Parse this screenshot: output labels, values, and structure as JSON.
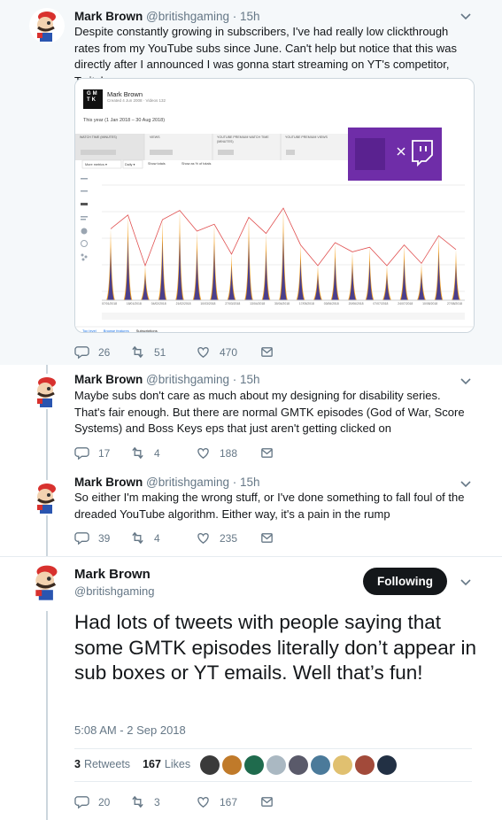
{
  "user": {
    "name": "Mark Brown",
    "handle": "@britishgaming"
  },
  "tweets": [
    {
      "time": "· 15h",
      "text": "Despite constantly growing in subscribers, I've had really low clickthrough rates from my YouTube subs since June. Can't help but notice that this was directly after I announced I was gonna start streaming on YT's competitor, Twitch...",
      "replies": "26",
      "retweets": "51",
      "likes": "470"
    },
    {
      "time": "· 15h",
      "text": "Maybe subs don't care as much about my designing for disability series. That's fair enough. But there are normal GMTK episodes (God of War, Score Systems) and Boss Keys eps that just aren't getting clicked on",
      "replies": "17",
      "retweets": "4",
      "likes": "188"
    },
    {
      "time": "· 15h",
      "text": "So either I'm making the wrong stuff, or I've done something to fall foul of the dreaded YouTube algorithm. Either way, it's a pain in the rump",
      "replies": "39",
      "retweets": "4",
      "likes": "235"
    }
  ],
  "main_tweet": {
    "follow_label": "Following",
    "text": "Had lots of tweets with people saying that some GMTK episodes literally don’t appear in sub boxes or YT emails. Well that’s fun!",
    "timestamp": "5:08 AM - 2 Sep 2018",
    "retweet_count": "3",
    "retweet_label": "Retweets",
    "like_count": "167",
    "like_label": "Likes",
    "replies": "20",
    "retweets": "3",
    "likes": "167"
  },
  "analytics_card": {
    "channel_name": "Mark Brown",
    "channel_sub": "Created 4 Jun 2008 · Videos 132",
    "date_range": "This year (1 Jan 2018 – 30 Aug 2018)",
    "metric_tabs": [
      "WATCH TIME (MINUTES)",
      "VIEWS",
      "YOUTUBE PREMIUM WATCH TIME (MINUTES)",
      "YOUTUBE PREMIUM VIEWS"
    ],
    "controls": [
      "More metrics ▾",
      "Daily ▾",
      "Show totals",
      "Show as % of totals"
    ],
    "logo_text": [
      "G",
      "M",
      "T",
      "K"
    ],
    "footer_links": [
      "Top level",
      "Browse features",
      "Subscriptions"
    ]
  },
  "chart_data": {
    "type": "area",
    "x": [
      "07/01/2018",
      "18/01/2018",
      "04/02/2018",
      "21/02/2018",
      "10/03/2018",
      "27/03/2018",
      "13/04/2018",
      "30/04/2018",
      "17/05/2018",
      "03/06/2018",
      "20/06/2018",
      "07/07/2018",
      "24/07/2018",
      "10/08/2018",
      "27/08/2018"
    ],
    "peaks_trend": [
      62,
      74,
      30,
      70,
      78,
      60,
      66,
      40,
      72,
      58,
      80,
      48,
      30,
      50,
      42,
      46,
      30,
      48,
      32,
      56,
      44
    ],
    "annotation": "red trend line connecting spikes"
  },
  "icons": [
    "reply-icon",
    "retweet-icon",
    "heart-icon",
    "mail-icon",
    "chevron-down-icon"
  ],
  "colors": {
    "accent": "#1da1f2",
    "muted": "#657786",
    "gmtk_purple": "#6f2da8",
    "twitch_purple": "#6441a4",
    "chart_purple": "#4b3f8c",
    "chart_orange": "#f4a01d",
    "trend_red": "#e05050"
  }
}
